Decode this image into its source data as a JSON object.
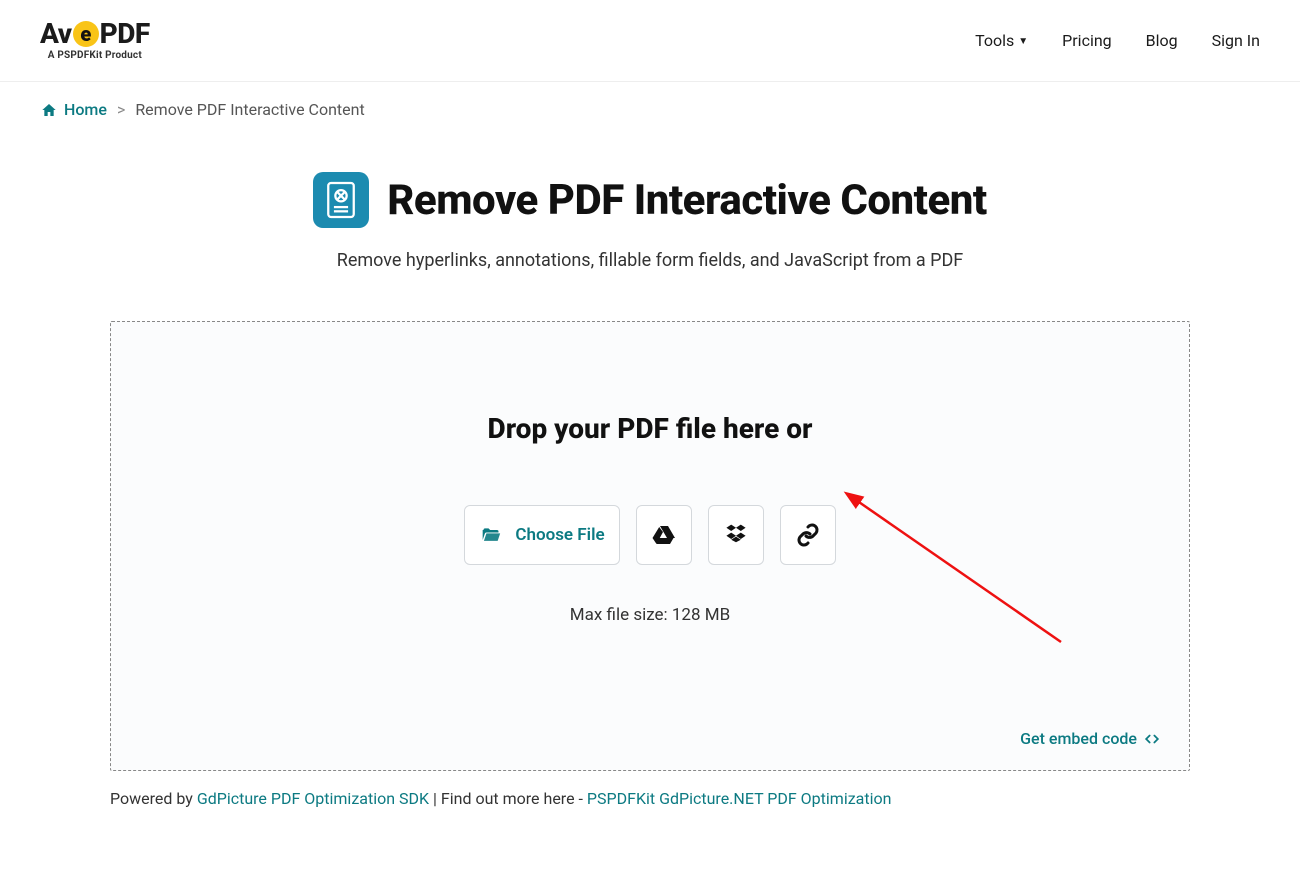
{
  "logo": {
    "prefix": "Av",
    "mid": "e",
    "suffix": "PDF",
    "tagline": "A PSPDFKit Product"
  },
  "nav": {
    "tools": "Tools",
    "pricing": "Pricing",
    "blog": "Blog",
    "signin": "Sign In"
  },
  "breadcrumb": {
    "home": "Home",
    "sep": ">",
    "current": "Remove PDF Interactive Content"
  },
  "page": {
    "title": "Remove PDF Interactive Content",
    "subtitle": "Remove hyperlinks, annotations, fillable form fields, and JavaScript from a PDF"
  },
  "drop": {
    "headline": "Drop your PDF file here or",
    "choose": "Choose File",
    "max": "Max file size: 128 MB",
    "embed": "Get embed code"
  },
  "footer": {
    "powered": "Powered by ",
    "link1": "GdPicture PDF Optimization SDK",
    "mid": " | Find out more here - ",
    "link2": "PSPDFKit GdPicture.NET PDF Optimization"
  }
}
